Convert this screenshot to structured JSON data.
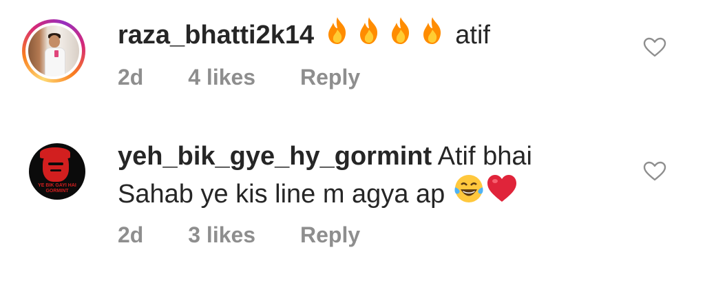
{
  "comments": [
    {
      "username": "raza_bhatti2k14",
      "text_after_emoji": "atif",
      "emoji": [
        "fire-emoji",
        "fire-emoji",
        "fire-emoji",
        "fire-emoji"
      ],
      "time": "2d",
      "likes": "4 likes",
      "reply": "Reply",
      "avatar_style": "story-ring"
    },
    {
      "username": "yeh_bik_gye_hy_gormint",
      "text_line1": "Atif bhai",
      "text_line2": "Sahab ye kis line m agya ap",
      "emoji": [
        "tears-of-joy-emoji",
        "red-heart-emoji"
      ],
      "avatar_text": "YE BIK GAYI HAI GORMINT",
      "time": "2d",
      "likes": "3 likes",
      "reply": "Reply",
      "avatar_style": "plain"
    }
  ],
  "colors": {
    "text": "#262626",
    "meta": "#8e8e8e",
    "fire": "#ff7a00",
    "heart": "#e0243a"
  }
}
